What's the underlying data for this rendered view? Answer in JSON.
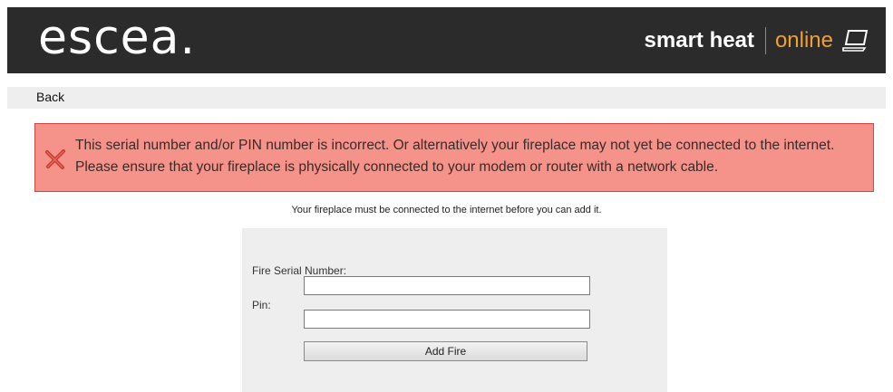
{
  "header": {
    "logo_text": "escea.",
    "tagline_bold": "smart heat",
    "tagline_accent": "online",
    "laptop_icon": "laptop-icon",
    "colors": {
      "background": "#2b2b2b",
      "accent": "#f0a030"
    }
  },
  "nav": {
    "back_label": "Back"
  },
  "error": {
    "icon": "error-x-icon",
    "message": "This serial number and/or PIN number is incorrect. Or alternatively your fireplace may not yet be connected to the internet. Please ensure that your fireplace is physically connected to your modem or router with a network cable.",
    "colors": {
      "background": "#f5938a",
      "border": "#d9433a"
    }
  },
  "notice": "Your fireplace must be connected to the internet before you can add it.",
  "form": {
    "serial_label": "Fire Serial Number:",
    "serial_value": "",
    "pin_label": "Pin:",
    "pin_value": "",
    "submit_label": "Add Fire"
  }
}
